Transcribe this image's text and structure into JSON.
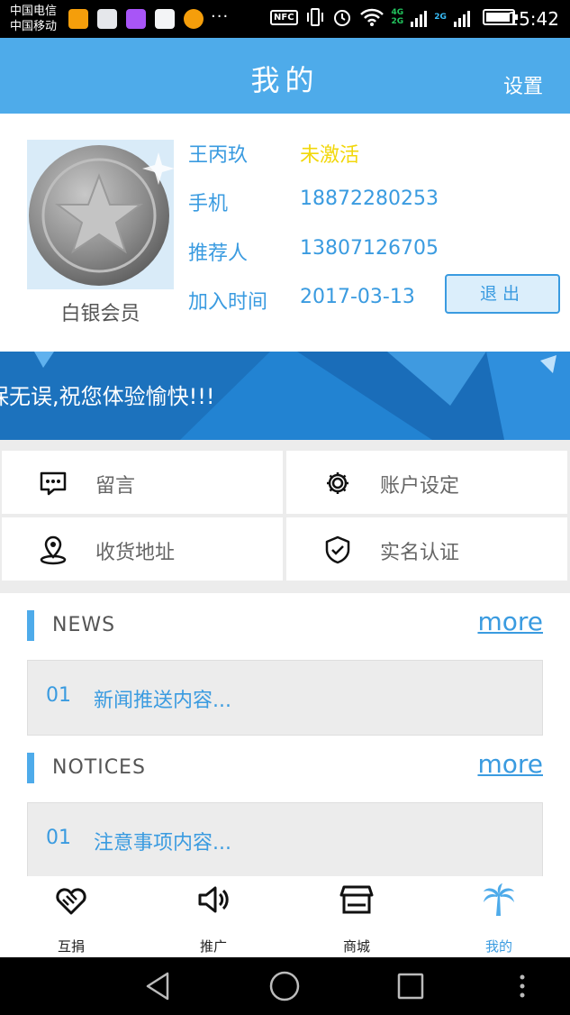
{
  "status_bar": {
    "carrier1": "中国电信",
    "carrier2": "中国移动",
    "more": "···",
    "nfc": "NFC",
    "net_4g": "4G",
    "net_2g_a": "2G",
    "net_2g_b": "2G",
    "time": "15:42"
  },
  "header": {
    "title": "我的",
    "settings_label": "设置"
  },
  "profile": {
    "name": "王丙玖",
    "status": "未激活",
    "phone_label": "手机",
    "phone": "18872280253",
    "referrer_label": "推荐人",
    "referrer": "13807126705",
    "join_label": "加入时间",
    "join_date": "2017-03-13",
    "member_level": "白银会员",
    "logout_label": "退出"
  },
  "banner": {
    "text": "保无误,祝您体验愉快!!!"
  },
  "menu": {
    "items": [
      {
        "label": "留言",
        "icon": "message-icon"
      },
      {
        "label": "账户设定",
        "icon": "gear-icon"
      },
      {
        "label": "收货地址",
        "icon": "location-pin-icon"
      },
      {
        "label": "实名认证",
        "icon": "shield-check-icon"
      }
    ]
  },
  "news": {
    "title": "NEWS",
    "more": "more",
    "items": [
      {
        "num": "01",
        "text": "新闻推送内容..."
      }
    ]
  },
  "notices": {
    "title": "NOTICES",
    "more": "more",
    "items": [
      {
        "num": "01",
        "text": "注意事项内容..."
      }
    ]
  },
  "tabs": [
    {
      "label": "互捐",
      "icon": "heart-handshake-icon",
      "active": false
    },
    {
      "label": "推广",
      "icon": "speaker-icon",
      "active": false
    },
    {
      "label": "商城",
      "icon": "store-icon",
      "active": false
    },
    {
      "label": "我的",
      "icon": "palm-tree-icon",
      "active": true
    }
  ],
  "colors": {
    "accent": "#4eabea",
    "link": "#3a9be0",
    "status_inactive": "#f2d70a"
  }
}
